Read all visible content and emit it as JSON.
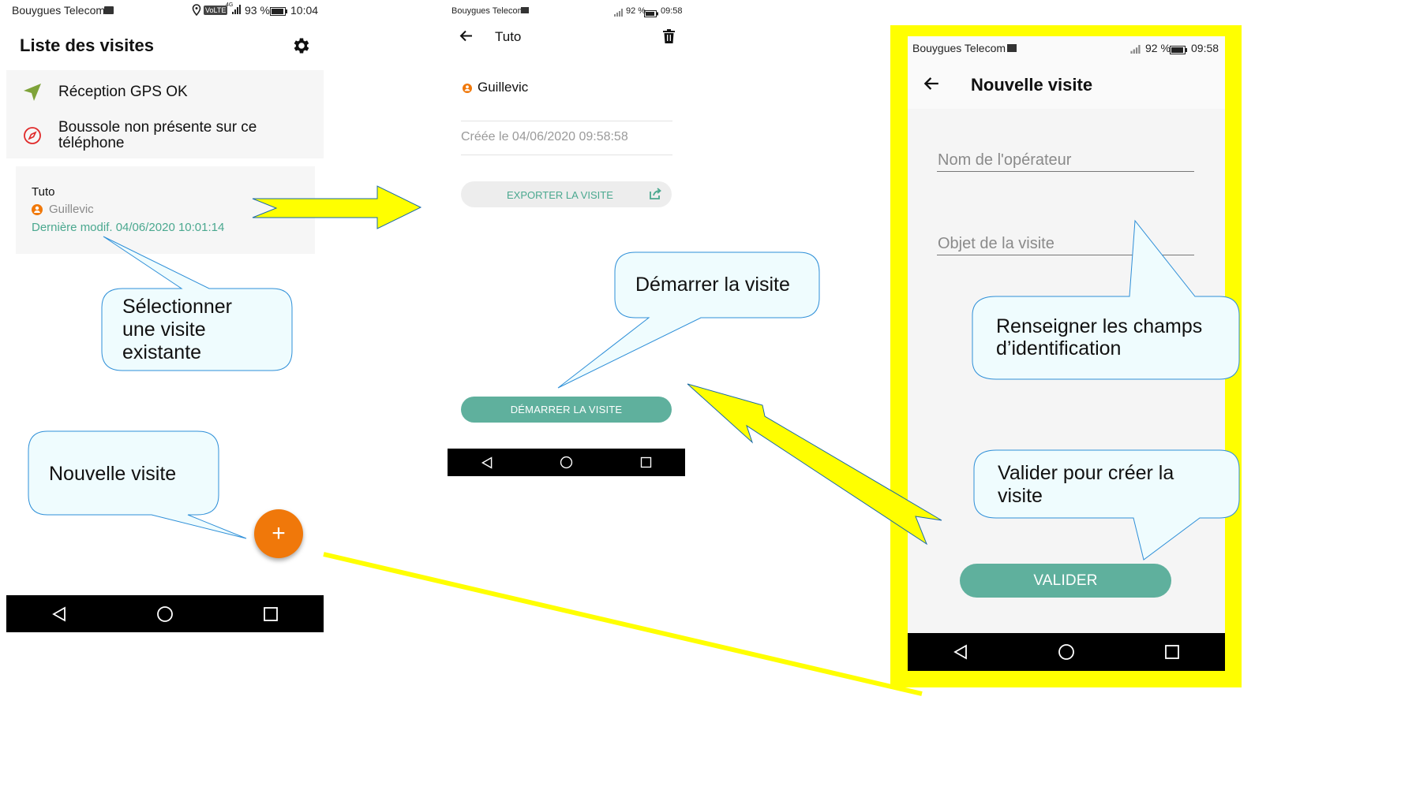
{
  "screen1": {
    "status": {
      "carrier": "Bouygues Telecom",
      "volte": "VoLTE",
      "network": "4G",
      "battery": "93 %",
      "time": "10:04"
    },
    "title": "Liste des visites",
    "gps_status": "Réception GPS OK",
    "compass_status": "Boussole non présente sur ce téléphone",
    "visit": {
      "name": "Tuto",
      "operator": "Guillevic",
      "modified": "Dernière modif. 04/06/2020 10:01:14"
    },
    "fab_label": "+"
  },
  "screen2": {
    "status": {
      "carrier": "Bouygues Telecom",
      "battery": "92 %",
      "time": "09:58"
    },
    "title": "Tuto",
    "operator": "Guillevic",
    "created": "Créée le 04/06/2020 09:58:58",
    "export_label": "EXPORTER LA VISITE",
    "start_label": "DÉMARRER LA VISITE"
  },
  "screen3": {
    "status": {
      "carrier": "Bouygues Telecom",
      "battery": "92 %",
      "time": "09:58"
    },
    "title": "Nouvelle visite",
    "operator_placeholder": "Nom de l'opérateur",
    "purpose_placeholder": "Objet de la visite",
    "validate_label": "VALIDER"
  },
  "callouts": {
    "select_existing": "Sélectionner une visite existante",
    "new_visit": "Nouvelle visite",
    "start_visit": "Démarrer la visite",
    "fill_fields": "Renseigner les champs d’identification",
    "validate_create": "Valider pour créer la visite"
  },
  "colors": {
    "teal": "#5fb09d",
    "orange": "#f0780a",
    "highlight": "#ffff00",
    "callout_fill": "#effcfe",
    "callout_stroke": "#2e8fd8"
  }
}
